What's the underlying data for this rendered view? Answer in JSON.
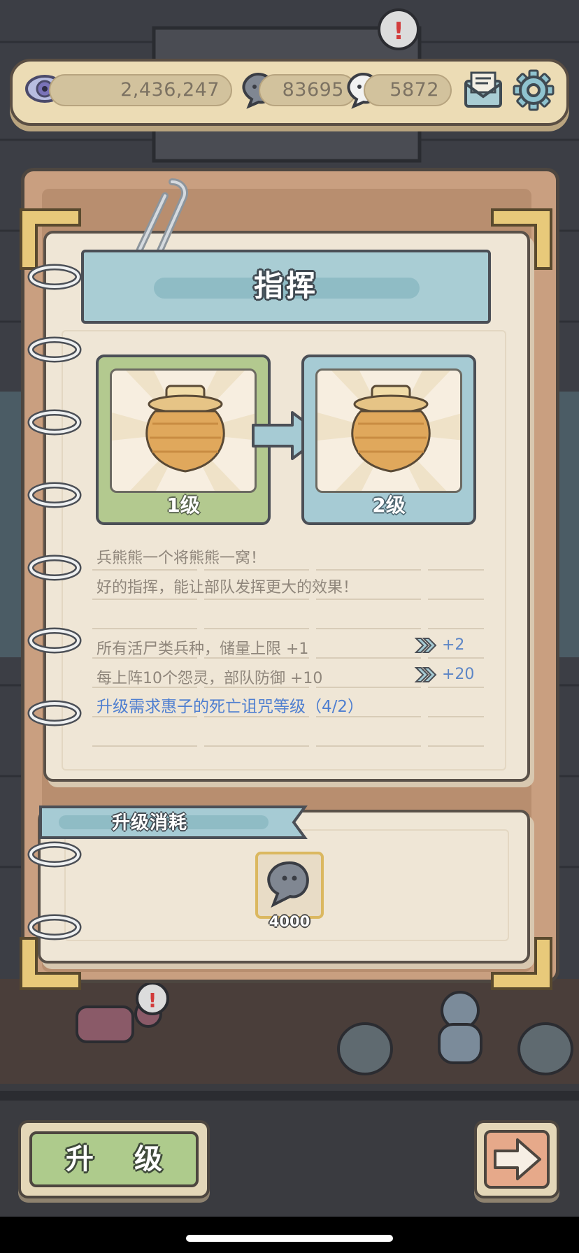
{
  "resources": {
    "vision": "2,436,247",
    "dark_soul": "83695",
    "light_soul": "5872"
  },
  "panel": {
    "title": "指挥",
    "current_level_label": "1级",
    "next_level_label": "2级",
    "description_lines": [
      "兵熊熊一个将熊熊一窝！",
      "好的指挥，能让部队发挥更大的效果！"
    ],
    "stats": [
      {
        "text": "所有活尸类兵种，储量上限 +1",
        "next": "+2"
      },
      {
        "text": "每上阵10个怨灵，部队防御 +10",
        "next": "+20"
      }
    ],
    "requirement": "升级需求惠子的死亡诅咒等级（4/2）"
  },
  "cost": {
    "title": "升级消耗",
    "item_icon": "dark-soul-icon",
    "amount": "4000"
  },
  "buttons": {
    "upgrade": "升 级",
    "next_icon": "arrow-right-icon"
  },
  "colors": {
    "panel_bg": "#efe6d6",
    "title_blue": "#a9cdd4",
    "card_green": "#b3c98f",
    "requirement_blue": "#4f7fd0",
    "next_value_blue": "#5d86c6",
    "upgrade_green": "#aecb8c",
    "next_orange": "#e6a98a"
  }
}
